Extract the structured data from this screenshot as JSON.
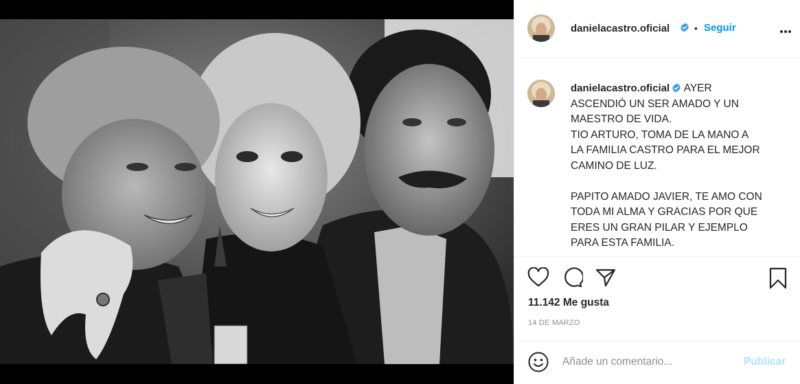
{
  "post": {
    "username": "danielacastro.oficial",
    "verified": true,
    "follow_label": "Seguir",
    "separator": "•",
    "caption_lines": "AYER\nASCENDIÓ UN SER AMADO Y UN\nMAESTRO DE VIDA.\nTIO ARTURO, TOMA DE LA MANO A\nLA FAMILIA CASTRO PARA EL MEJOR\nCAMINO DE LUZ.\n\nPAPITO AMADO JAVIER, TE AMO CON\nTODA MI ALMA Y GRACIAS POR QUE\nERES UN GRAN PILAR Y EJEMPLO\nPARA ESTA FAMILIA.",
    "likes": "11.142 Me gusta",
    "date": "14 DE MARZO"
  },
  "comment": {
    "placeholder": "Añade un comentario...",
    "publish_label": "Publicar"
  },
  "icons": {
    "verified": "verified-badge-icon",
    "more": "more-options-icon",
    "like": "heart-icon",
    "comment": "comment-icon",
    "share": "paper-plane-icon",
    "save": "bookmark-icon",
    "emoji": "emoji-icon"
  },
  "colors": {
    "accent": "#0095f6",
    "publish_disabled": "#b2dffc",
    "text": "#262626",
    "muted": "#8e8e8e",
    "media_bg": "#000000"
  }
}
